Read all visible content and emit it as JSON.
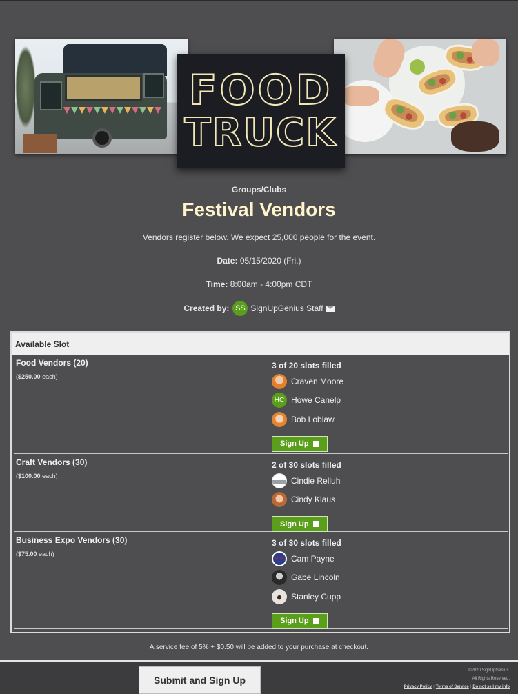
{
  "banner": {
    "sign_line1": "FOOD",
    "sign_line2": "TRUCK"
  },
  "header": {
    "category": "Groups/Clubs",
    "title": "Festival Vendors",
    "description": "Vendors register below. We expect 25,000 people for the event.",
    "date_label": "Date:",
    "date_value": "05/15/2020 (Fri.)",
    "time_label": "Time:",
    "time_value": "8:00am - 4:00pm CDT",
    "created_label": "Created by:",
    "creator_initials": "SS",
    "creator_name": "SignUpGenius Staff"
  },
  "table": {
    "header": "Available Slot",
    "slots": [
      {
        "title": "Food Vendors (20)",
        "price": "$250.00",
        "price_suffix": "each",
        "filled": "3 of 20 slots filled",
        "people": [
          "Craven Moore",
          "Howe Canelp",
          "Bob Loblaw"
        ],
        "signup_label": "Sign Up"
      },
      {
        "title": "Craft Vendors (30)",
        "price": "$100.00",
        "price_suffix": "each",
        "filled": "2 of 30 slots filled",
        "people": [
          "Cindie Relluh",
          "Cindy Klaus"
        ],
        "signup_label": "Sign Up"
      },
      {
        "title": "Business Expo Vendors (30)",
        "price": "$75.00",
        "price_suffix": "each",
        "filled": "3 of 30 slots filled",
        "people": [
          "Cam Payne",
          "Gabe Lincoln",
          "Stanley Cupp"
        ],
        "signup_label": "Sign Up"
      }
    ],
    "howe_initials": "HC",
    "cam_badge": "VOTE"
  },
  "fee_note": "A service fee of 5% + $0.50 will be added to your purchase at checkout.",
  "footer": {
    "submit_label": "Submit and Sign Up",
    "copyright": "©2020 SignUpGenius.",
    "rights": "All Rights Reserved.",
    "privacy": "Privacy Policy",
    "terms": "Terms of Service",
    "donotsell": "Do not sell my info"
  },
  "colors": {
    "background": "#4e4d50",
    "accent_green": "#5a9e1b",
    "title_cream": "#fff4cc"
  }
}
